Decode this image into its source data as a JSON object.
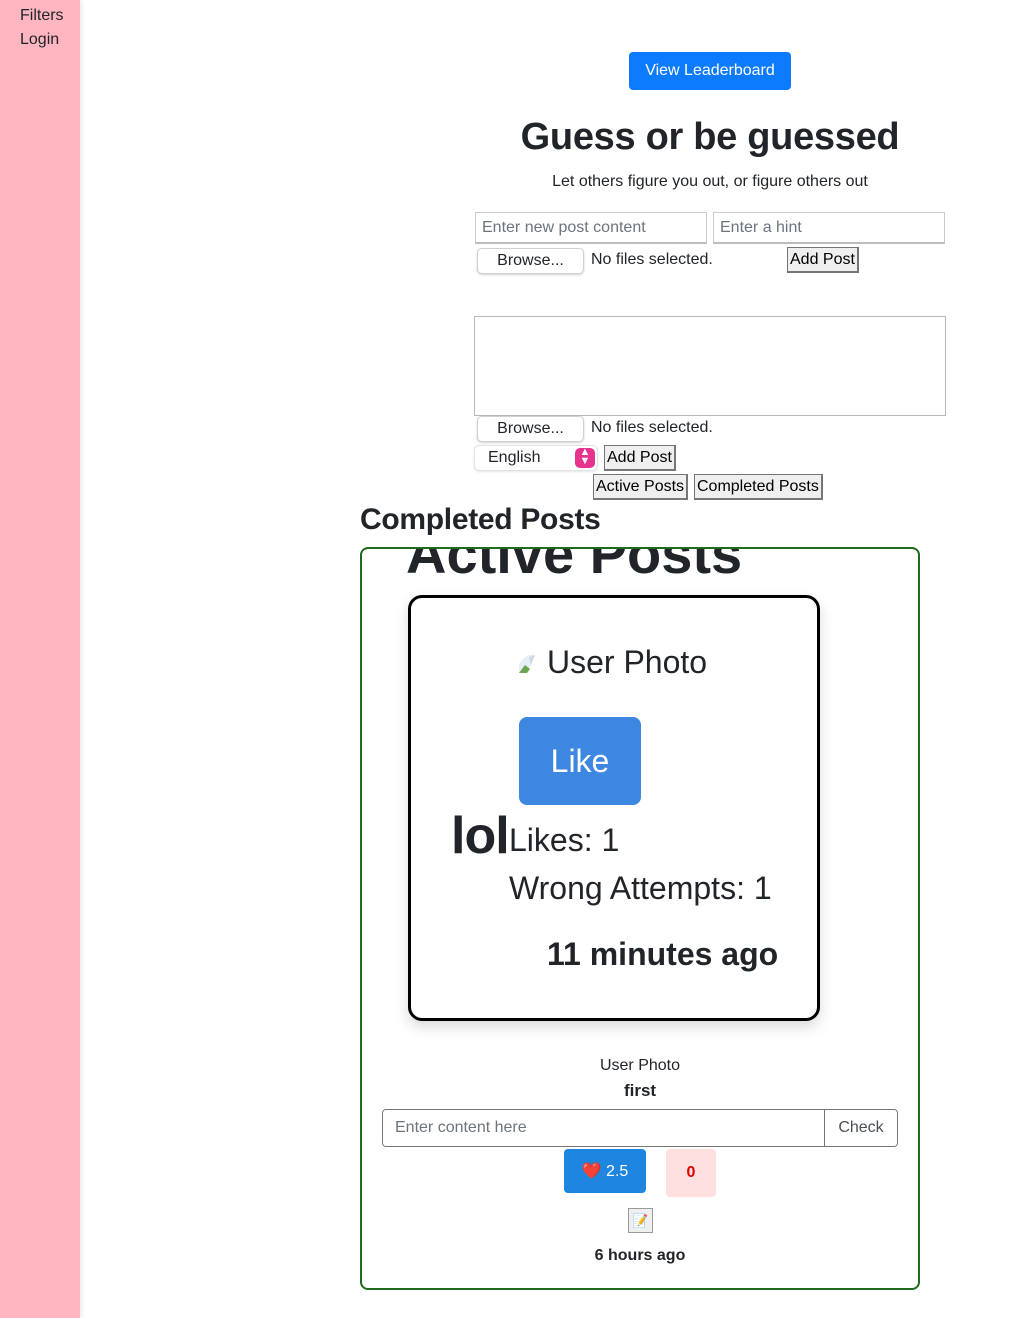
{
  "sidebar": {
    "filters": "Filters",
    "login": "Login"
  },
  "header": {
    "leaderboard_button": "View Leaderboard",
    "title": "Guess or be guessed",
    "subtitle": "Let others figure you out, or figure others out"
  },
  "form1": {
    "content_placeholder": "Enter new post content",
    "hint_placeholder": "Enter a hint",
    "browse_label": "Browse...",
    "no_files": "No files selected.",
    "add_post": "Add Post"
  },
  "form2": {
    "browse_label": "Browse...",
    "no_files": "No files selected.",
    "language": "English",
    "add_post": "Add Post"
  },
  "tabs": {
    "active": "Active Posts",
    "completed": "Completed Posts"
  },
  "section_title": "Completed Posts",
  "panel": {
    "clipped_heading": "Active Posts",
    "card": {
      "photo_alt": "User Photo",
      "like_button": "Like",
      "content": "lol",
      "likes": "Likes: 1",
      "wrong_attempts": "Wrong Attempts: 1",
      "time": "11 minutes ago"
    },
    "post": {
      "photo_alt": "User Photo",
      "content": "first",
      "guess_placeholder": "Enter content here",
      "check_button": "Check",
      "heart_label": "❤️ 2.5",
      "count_label": "0",
      "edit_icon": "📝",
      "time": "6 hours ago"
    }
  }
}
